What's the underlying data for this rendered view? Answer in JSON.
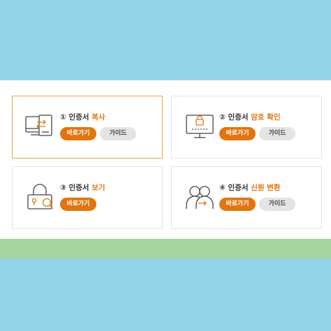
{
  "cards": [
    {
      "number": "①",
      "title_plain": "인증서",
      "title_highlight": "복사",
      "primary_label": "바로가기",
      "guide_label": "가이드",
      "icon": "pc-transfer-icon"
    },
    {
      "number": "②",
      "title_plain": "인증서",
      "title_highlight": "암호 확인",
      "primary_label": "바로가기",
      "guide_label": "가이드",
      "icon": "monitor-lock-icon"
    },
    {
      "number": "③",
      "title_plain": "인증서",
      "title_highlight": "보기",
      "primary_label": "바로가기",
      "icon": "lock-search-icon"
    },
    {
      "number": "④",
      "title_plain": "인증서",
      "title_highlight": "신원 변환",
      "primary_label": "바로가기",
      "guide_label": "가이드",
      "icon": "users-transfer-icon"
    }
  ],
  "colors": {
    "accent": "#e2750e",
    "active_border": "#f0a24a",
    "guide_bg": "#e4e4e4",
    "background_blue": "#93d3e8",
    "background_green": "#a6d4a0"
  }
}
